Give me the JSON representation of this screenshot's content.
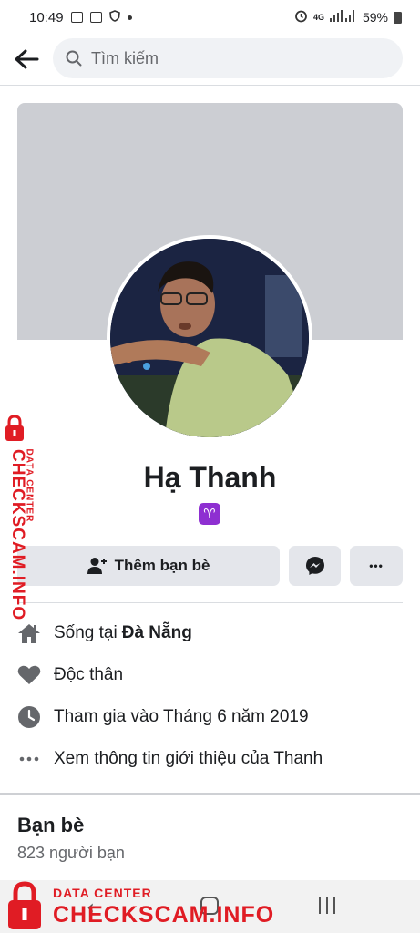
{
  "status_bar": {
    "time": "10:49",
    "network": "4G",
    "battery": "59%"
  },
  "search": {
    "placeholder": "Tìm kiếm"
  },
  "profile": {
    "name": "Hạ Thanh",
    "zodiac_symbol": "♈",
    "zodiac_color": "#8e2fd1"
  },
  "actions": {
    "add_friend_label": "Thêm bạn bè",
    "more_label": "•••"
  },
  "info": {
    "lives_in_prefix": "Sống tại",
    "lives_in_city": "Đà Nẵng",
    "relationship": "Độc thân",
    "joined": "Tham gia vào Tháng 6 năm 2019",
    "see_about": "Xem thông tin giới thiệu của Thanh"
  },
  "friends": {
    "title": "Bạn bè",
    "count": "823 người bạn"
  },
  "watermark": {
    "small": "DATA CENTER",
    "big": "CHECKSCAM.INFO",
    "color": "#e01c24"
  },
  "icons": {
    "back": "arrow-left-icon",
    "search": "search-icon",
    "add_friend": "person-add-icon",
    "messenger": "messenger-icon",
    "home": "house-icon",
    "relationship": "heart-icon",
    "joined": "clock-icon",
    "more": "ellipsis-icon"
  }
}
